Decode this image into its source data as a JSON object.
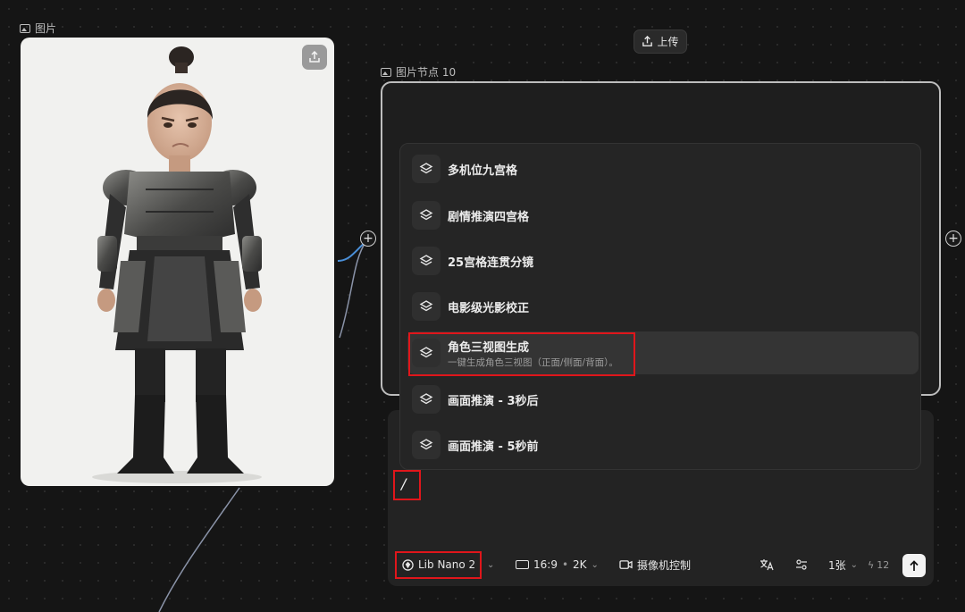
{
  "canvas": {
    "image_node_label": "图片",
    "node10_label": "图片节点 10",
    "upload_label": "上传"
  },
  "menu": {
    "items": [
      {
        "label": "多机位九宫格",
        "desc": ""
      },
      {
        "label": "剧情推演四宫格",
        "desc": ""
      },
      {
        "label": "25宫格连贯分镜",
        "desc": ""
      },
      {
        "label": "电影级光影校正",
        "desc": ""
      },
      {
        "label": "角色三视图生成",
        "desc": "一键生成角色三视图（正面/侧面/背面）。"
      },
      {
        "label": "画面推演 - 3秒后",
        "desc": ""
      },
      {
        "label": "画面推演 - 5秒前",
        "desc": ""
      }
    ],
    "active_index": 4
  },
  "prompt": {
    "value": "/"
  },
  "toolbar": {
    "model": "Lib Nano 2",
    "aspect": "16:9",
    "dot": "•",
    "resolution": "2K",
    "camera": "摄像机控制",
    "count": "1张",
    "credits": "12"
  },
  "colors": {
    "highlight_red": "#e0161b",
    "accent_blue": "#4a8fd8"
  }
}
